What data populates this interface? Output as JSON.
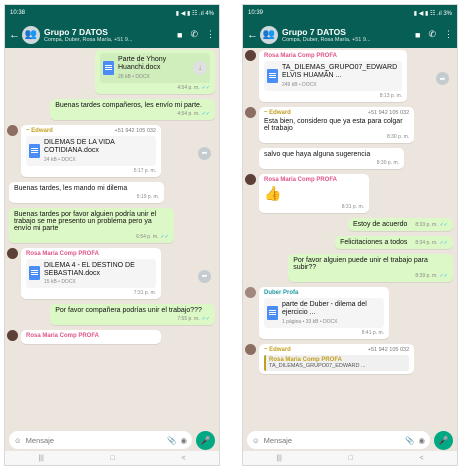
{
  "screen1": {
    "status_time": "10:38",
    "status_icons": "▮ ◀ ▮ ☷ .ıl 4%",
    "title": "Grupo 7 DATOS",
    "subtitle": "Compa, Duber, Rosa María, +51 9...",
    "input_placeholder": "Mensaje",
    "nav": [
      "|||",
      "□",
      "<"
    ],
    "messages": {
      "m1_doc": "Parte de Yhony Huanchi.docx",
      "m1_meta": "26 kB • DOCX",
      "m1_time": "4:54 p. m.",
      "m2_text": "Buenas tardes compañeros, les envío mi parte.",
      "m2_time": "4:54 p. m.",
      "m3_sender": "~ Edward",
      "m3_phone": "+51 942 105 032",
      "m3_doc": "DILEMAS DE LA VIDA COTIDIANA.docx",
      "m3_meta": "24 kB • DOCX",
      "m3_time": "5:17 p. m.",
      "m4_text": "Buenas tardes, les mando mi dilema",
      "m4_time": "5:19 p. m.",
      "m5_text": "Buenas tardes por favor alguien podría unir el trabajo se me presento un problema pero ya envío mi parte",
      "m5_time": "6:54 p. m.",
      "m6_sender": "Rosa Maria Comp PROFA",
      "m6_doc": "DILEMA 4 - EL DESTINO DE SEBASTIAN.docx",
      "m6_meta": "15 kB • DOCX",
      "m6_time": "7:31 p. m.",
      "m7_text": "Por favor compañera podrías unir el trabajo???",
      "m7_time": "7:55 p. m.",
      "m8_sender": "Rosa Maria Comp PROFA"
    }
  },
  "screen2": {
    "status_time": "10:39",
    "status_icons": "▮ ◀ ▮ ☷ .ıl 3%",
    "title": "Grupo 7 DATOS",
    "subtitle": "Compa, Duber, Rosa María, +51 9...",
    "input_placeholder": "Mensaje",
    "nav": [
      "|||",
      "□",
      "<"
    ],
    "messages": {
      "n1_sender": "Rosa Maria Comp PROFA",
      "n1_doc": "TA_DILEMAS_GRUPO07_EDWARD ELVIS HUAMÁN ...",
      "n1_meta": "249 kB • DOCX",
      "n1_time": "8:13 p. m.",
      "n2_sender": "~ Edward",
      "n2_phone": "+51 942 105 032",
      "n2_text": "Esta bien, considero que ya esta para colgar el trabajo",
      "n2_time": "8:30 p. m.",
      "n3_text": "salvo que haya alguna sugerencia",
      "n3_time": "8:30 p. m.",
      "n4_sender": "Rosa Maria Comp PROFA",
      "n4_emoji": "👍",
      "n4_time": "8:31 p. m.",
      "n5_text": "Estoy de acuerdo",
      "n5_time": "8:33 p. m.",
      "n6_text": "Felicitaciones a todos",
      "n6_time": "8:34 p. m.",
      "n7_text": "Por favor alguien puede unir el trabajo para subir??",
      "n7_time": "8:39 p. m.",
      "n8_sender": "Duber Profa",
      "n8_doc": "parte de Duber - dilema del ejercicio ...",
      "n8_meta": "1 página • 33 kB • DOCX",
      "n8_time": "8:41 p. m.",
      "n9_sender": "~ Edward",
      "n9_phone": "+51 942 105 032",
      "n9_quote_sender": "Rosa Maria Comp PROFA",
      "n9_quote_text": "TA_DILEMAS_GRUPO07_EDWARD ..."
    }
  }
}
